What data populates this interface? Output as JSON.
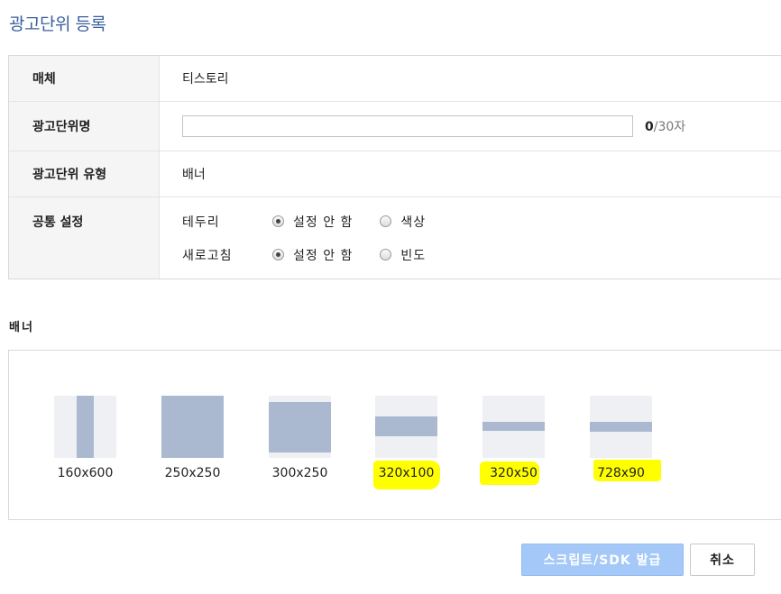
{
  "page_title": "광고단위 등록",
  "form": {
    "media": {
      "label": "매체",
      "value": "티스토리"
    },
    "unit_name": {
      "label": "광고단위명",
      "value": "",
      "placeholder": "",
      "count": "0",
      "max": "/30자"
    },
    "unit_type": {
      "label": "광고단위 유형",
      "value": "배너"
    },
    "common": {
      "label": "공통 설정",
      "border": {
        "label": "테두리",
        "option_off": "설정 안 함",
        "option_on": "색상",
        "selected": "off"
      },
      "refresh": {
        "label": "새로고침",
        "option_off": "설정 안 함",
        "option_on": "빈도",
        "selected": "off"
      }
    }
  },
  "banner": {
    "title": "배너",
    "sizes": [
      {
        "label": "160x600",
        "highlighted": false
      },
      {
        "label": "250x250",
        "highlighted": false
      },
      {
        "label": "300x250",
        "highlighted": false
      },
      {
        "label": "320x100",
        "highlighted": true
      },
      {
        "label": "320x50",
        "highlighted": true
      },
      {
        "label": "728x90",
        "highlighted": true
      }
    ]
  },
  "buttons": {
    "issue": "스크립트/SDK 발급",
    "cancel": "취소"
  },
  "colors": {
    "accent": "#3b5f9c",
    "thumb_fill": "#aab9d0",
    "thumb_bg": "#eef0f3",
    "issue_button": "#a4c8f8",
    "highlight": "#ffff00"
  }
}
